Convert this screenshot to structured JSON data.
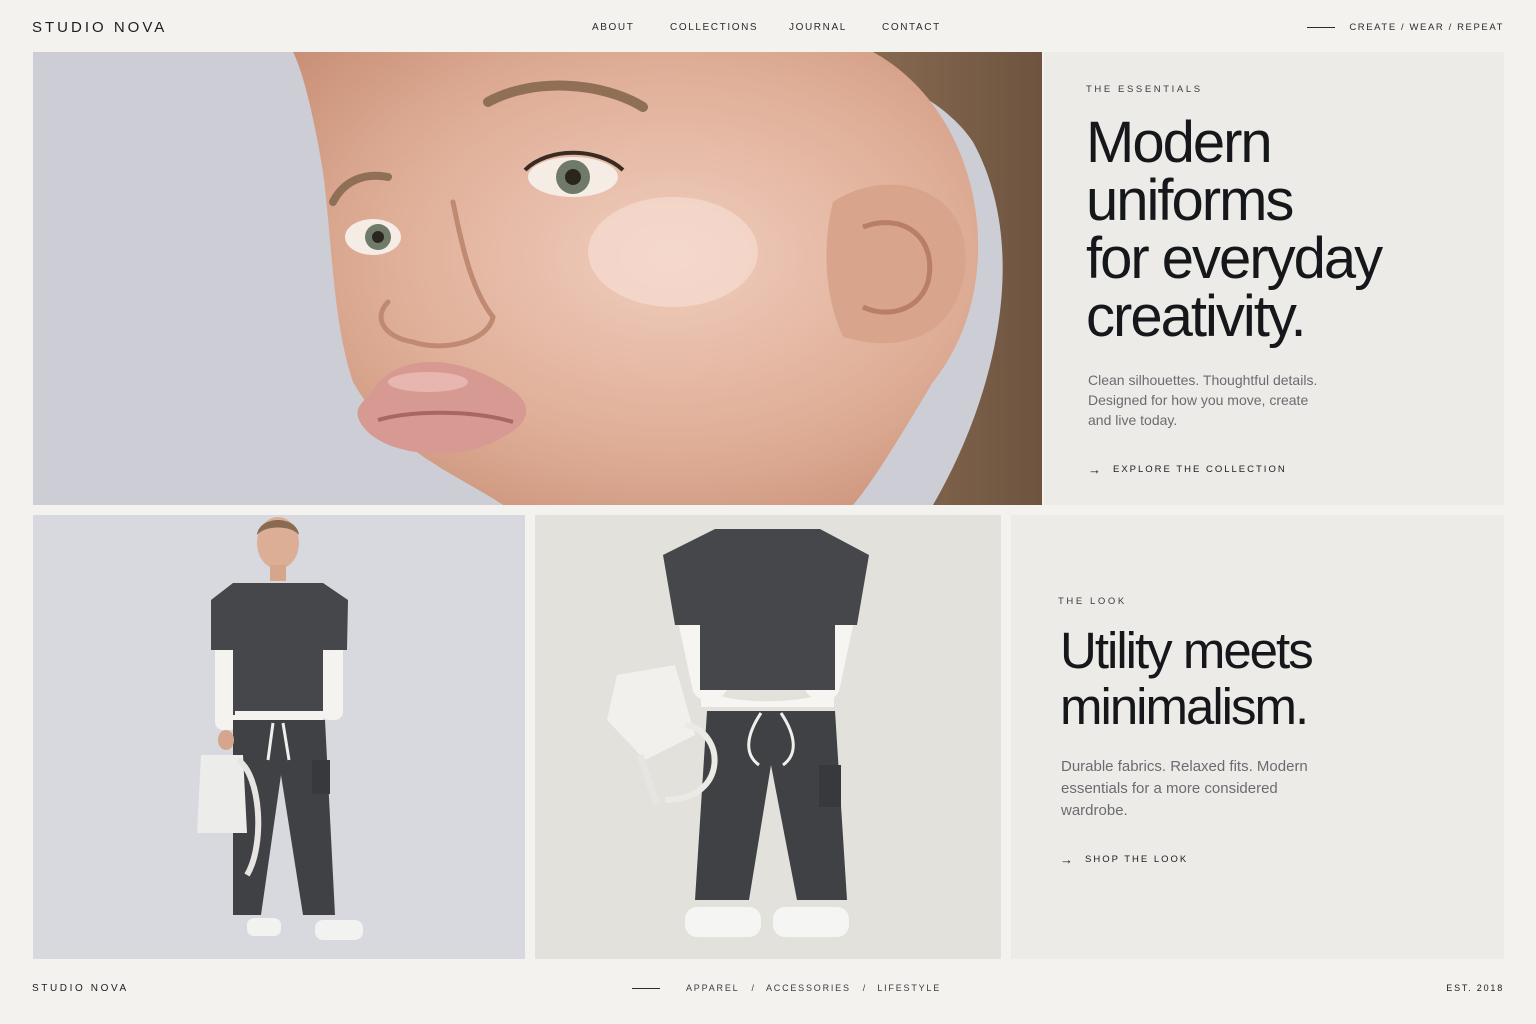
{
  "header": {
    "brand": "STUDIO NOVA",
    "nav": [
      {
        "label": "ABOUT"
      },
      {
        "label": "COLLECTIONS"
      },
      {
        "label": "JOURNAL"
      },
      {
        "label": "CONTACT"
      }
    ],
    "tagline": "CREATE / WEAR / REPEAT"
  },
  "hero": {
    "image_alt": "close-up portrait of woman",
    "eyebrow": "THE ESSENTIALS",
    "headline_lines": [
      "Modern",
      "uniforms",
      "for everyday",
      "creativity."
    ],
    "body_lines": [
      "Clean silhouettes. Thoughtful details.",
      "Designed for how you move, create",
      "and live today."
    ],
    "cta": "EXPLORE THE COLLECTION"
  },
  "look": {
    "eyebrow": "THE LOOK",
    "headline_lines": [
      "Utility meets",
      "minimalism."
    ],
    "body_lines": [
      "Durable fabrics. Relaxed fits. Modern",
      "essentials for a more considered",
      "wardrobe."
    ],
    "cta": "SHOP THE LOOK"
  },
  "footer": {
    "brand": "STUDIO NOVA",
    "links": [
      {
        "label": "APPAREL"
      },
      {
        "label": "ACCESSORIES"
      },
      {
        "label": "LIFESTYLE"
      }
    ],
    "separator": "/",
    "est": "EST. 2018"
  },
  "colors": {
    "background": "#f4f2ef",
    "panel": "#ecebe8",
    "ink": "#16171a",
    "muted": "#6b6c70",
    "garment": "#45474b"
  },
  "icons": {
    "cta_arrow": "arrow-right-icon"
  }
}
